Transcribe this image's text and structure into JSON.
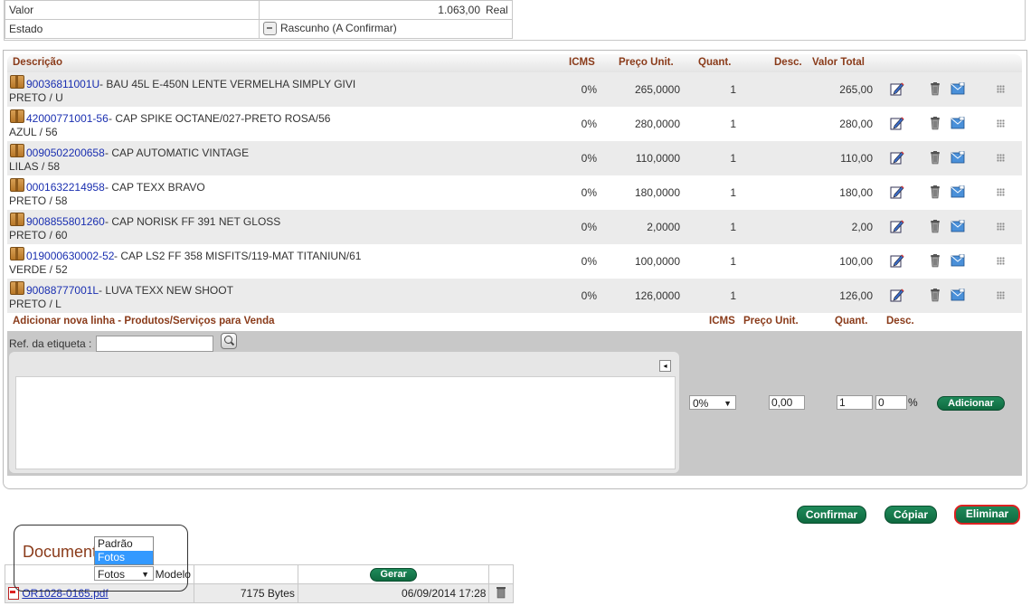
{
  "info": {
    "valor_label": "Valor",
    "valor_value": "1.063,00",
    "valor_currency": "Real",
    "estado_label": "Estado",
    "estado_value": "Rascunho (A Confirmar)"
  },
  "table": {
    "headers": {
      "descricao": "Descrição",
      "icms": "ICMS",
      "preco": "Preço Unit.",
      "quant": "Quant.",
      "desc": "Desc.",
      "total": "Valor Total"
    },
    "rows": [
      {
        "code": "90036811001U",
        "desc": " - BAU 45L E-450N LENTE VERMELHA SIMPLY GIVI",
        "variant": "PRETO / U",
        "icms": "0%",
        "preco": "265,0000",
        "quant": "1",
        "total": "265,00"
      },
      {
        "code": "42000771001-56",
        "desc": " - CAP SPIKE OCTANE/027-PRETO ROSA/56",
        "variant": "AZUL / 56",
        "icms": "0%",
        "preco": "280,0000",
        "quant": "1",
        "total": "280,00"
      },
      {
        "code": "0090502200658",
        "desc": " - CAP AUTOMATIC VINTAGE",
        "variant": "LILAS / 58",
        "icms": "0%",
        "preco": "110,0000",
        "quant": "1",
        "total": "110,00"
      },
      {
        "code": "0001632214958",
        "desc": " - CAP TEXX BRAVO",
        "variant": "PRETO / 58",
        "icms": "0%",
        "preco": "180,0000",
        "quant": "1",
        "total": "180,00"
      },
      {
        "code": "9008855801260",
        "desc": " - CAP NORISK FF 391 NET GLOSS",
        "variant": "PRETO / 60",
        "icms": "0%",
        "preco": "2,0000",
        "quant": "1",
        "total": "2,00"
      },
      {
        "code": "019000630002-52",
        "desc": " - CAP LS2 FF 358 MISFITS/119-MAT TITANIUN/61",
        "variant": "VERDE / 52",
        "icms": "0%",
        "preco": "100,0000",
        "quant": "1",
        "total": "100,00"
      },
      {
        "code": "90088777001L",
        "desc": " - LUVA TEXX NEW SHOOT",
        "variant": "PRETO / L",
        "icms": "0%",
        "preco": "126,0000",
        "quant": "1",
        "total": "126,00"
      }
    ]
  },
  "addline": {
    "title": "Adicionar nova linha - Produtos/Serviços para Venda",
    "icms": "ICMS",
    "preco": "Preço Unit.",
    "quant": "Quant.",
    "desc": "Desc.",
    "ref_label": "Ref. da etiqueta :",
    "icms_selected": "0%",
    "preco_value": "0,00",
    "quant_value": "1",
    "desc_value": "0",
    "percent": "%",
    "add_button": "Adicionar"
  },
  "actions": {
    "confirmar": "Confirmar",
    "copiar": "Cópiar",
    "eliminar": "Eliminar"
  },
  "documents": {
    "title": "Documentos",
    "modelo_label": "Modelo",
    "modelo_selected": "Fotos",
    "options": [
      "Padrão",
      "Fotos"
    ],
    "gerar": "Gerar",
    "file_name": "OR1028-0165.pdf",
    "file_size": "7175 Bytes",
    "file_date": "06/09/2014 17:28"
  },
  "colors": {
    "header_text": "#8a3b1a",
    "link": "#1a2fb0",
    "button_green": "#1f8a5a"
  }
}
